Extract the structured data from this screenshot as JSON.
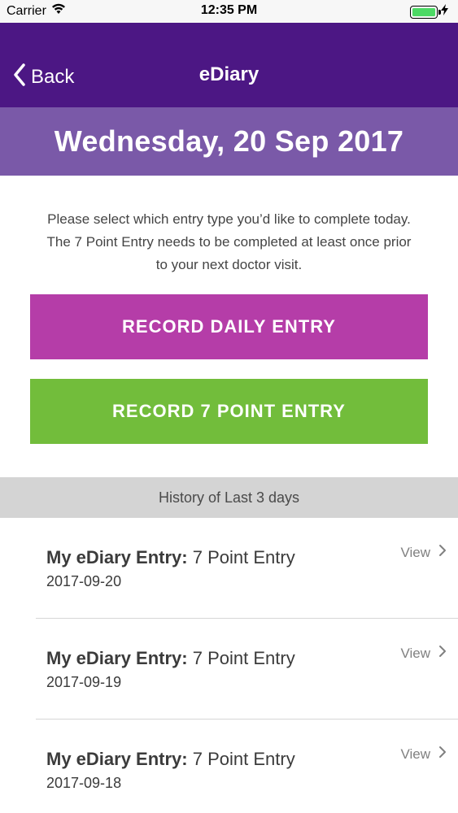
{
  "status_bar": {
    "carrier": "Carrier",
    "time": "12:35 PM",
    "battery_level_percent": 100
  },
  "nav": {
    "back_label": "Back",
    "title": "eDiary"
  },
  "date_banner": {
    "date": "Wednesday, 20 Sep 2017"
  },
  "instructions": {
    "line1": "Please select which entry type you’d like to complete today.",
    "line2": "The 7 Point Entry needs to be completed at least once prior",
    "line3": "to your next doctor visit."
  },
  "buttons": {
    "daily_label": "RECORD DAILY ENTRY",
    "seven_point_label": "RECORD 7 POINT ENTRY"
  },
  "history": {
    "header": "History of Last 3 days",
    "entries": [
      {
        "title_prefix": "My eDiary Entry:",
        "title_type": "7 Point Entry",
        "date": "2017-09-20",
        "action": "View"
      },
      {
        "title_prefix": "My eDiary Entry:",
        "title_type": "7 Point Entry",
        "date": "2017-09-19",
        "action": "View"
      },
      {
        "title_prefix": "My eDiary Entry:",
        "title_type": "7 Point Entry",
        "date": "2017-09-18",
        "action": "View"
      }
    ]
  },
  "colors": {
    "nav_bg": "#4c1784",
    "banner_bg": "#7a59a8",
    "daily_button": "#b53da8",
    "seven_point_button": "#72bd3b",
    "history_header_bg": "#d4d4d4",
    "battery": "#4cd964"
  },
  "icons": {
    "wifi": "wifi-icon",
    "charging": "charging-bolt-icon",
    "back": "chevron-left-icon",
    "disclosure": "chevron-right-icon"
  }
}
